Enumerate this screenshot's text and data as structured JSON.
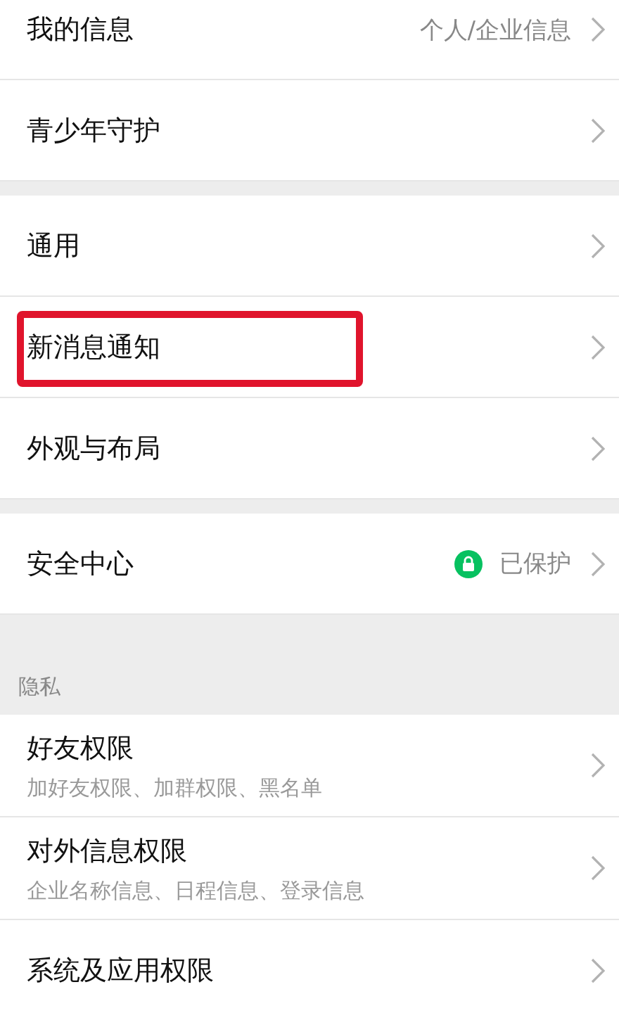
{
  "groups": [
    {
      "items": [
        {
          "kind": "link",
          "label": "我的信息",
          "value": "个人/企业信息",
          "highlighted": false
        },
        {
          "kind": "link",
          "label": "青少年守护",
          "highlighted": false
        }
      ]
    },
    {
      "items": [
        {
          "kind": "link",
          "label": "通用",
          "highlighted": false
        },
        {
          "kind": "link",
          "label": "新消息通知",
          "highlighted": true
        },
        {
          "kind": "link",
          "label": "外观与布局",
          "highlighted": false
        }
      ]
    },
    {
      "items": [
        {
          "kind": "secured",
          "label": "安全中心",
          "value": "已保护",
          "highlighted": false
        }
      ]
    },
    {
      "header": "隐私",
      "items": [
        {
          "kind": "link",
          "label": "好友权限",
          "subtitle": "加好友权限、加群权限、黑名单",
          "highlighted": false
        },
        {
          "kind": "link",
          "label": "对外信息权限",
          "subtitle": "企业名称信息、日程信息、登录信息",
          "highlighted": false
        },
        {
          "kind": "link",
          "label": "系统及应用权限",
          "highlighted": false
        }
      ]
    }
  ]
}
